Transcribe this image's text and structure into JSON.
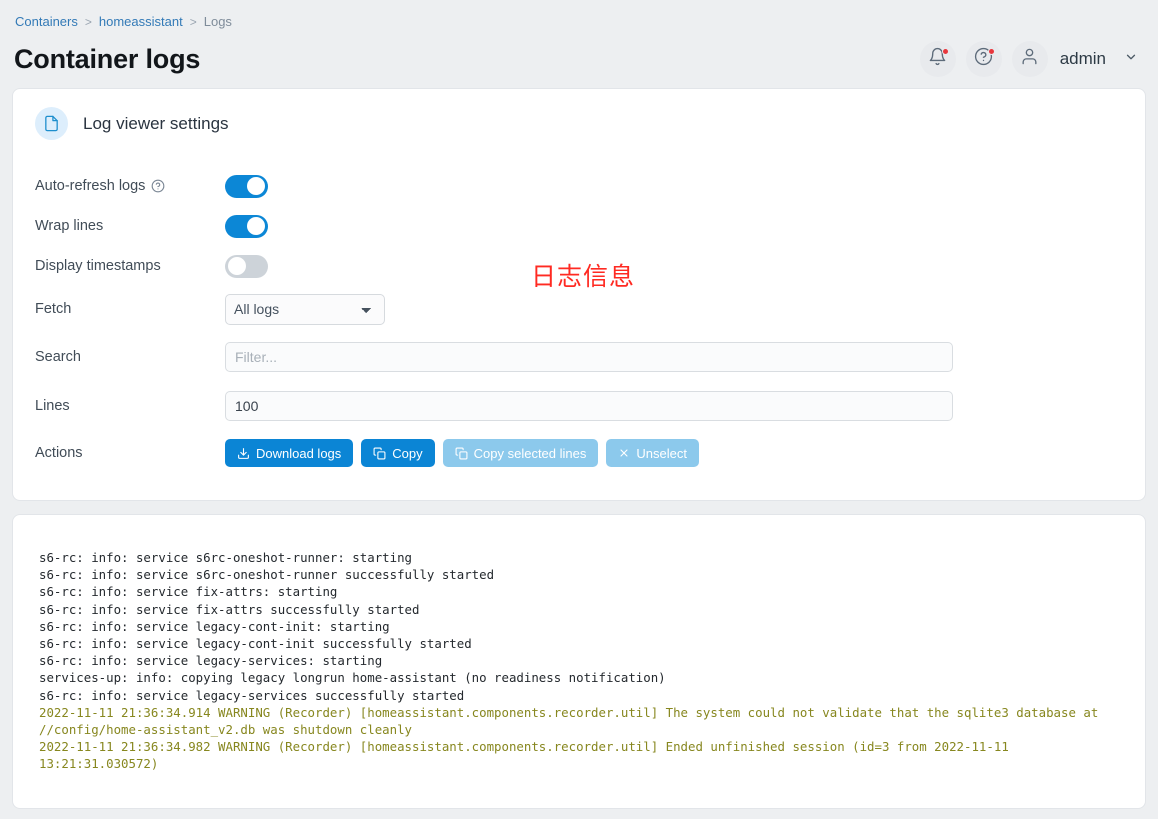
{
  "breadcrumb": {
    "items": [
      {
        "label": "Containers",
        "link": true
      },
      {
        "label": "homeassistant",
        "link": true
      },
      {
        "label": "Logs",
        "link": false
      }
    ],
    "separator": ">"
  },
  "header": {
    "title": "Container logs",
    "user": "admin",
    "notifications_icon": "bell-icon",
    "help_icon": "help-circle-icon",
    "avatar_icon": "user-icon",
    "chevron": "⌄"
  },
  "settings": {
    "card_title": "Log viewer settings",
    "card_icon": "document-icon",
    "annotation": "日志信息",
    "annotation_color": "#ff2a22",
    "rows": {
      "auto_refresh_label": "Auto-refresh logs",
      "auto_refresh_state": "on",
      "wrap_lines_label": "Wrap lines",
      "wrap_lines_state": "on",
      "timestamps_label": "Display timestamps",
      "timestamps_state": "off",
      "fetch_label": "Fetch",
      "fetch_value": "All logs",
      "fetch_options": [
        "All logs"
      ],
      "search_label": "Search",
      "search_value": "",
      "search_placeholder": "Filter...",
      "lines_label": "Lines",
      "lines_value": "100",
      "actions_label": "Actions"
    },
    "buttons": [
      {
        "label": "Download logs",
        "icon": "download-icon",
        "enabled": true
      },
      {
        "label": "Copy",
        "icon": "copy-icon",
        "enabled": true
      },
      {
        "label": "Copy selected lines",
        "icon": "copy-icon",
        "enabled": false
      },
      {
        "label": "Unselect",
        "icon": "close-icon",
        "enabled": false
      }
    ],
    "accent_color": "#0b85d5",
    "disabled_color": "#8cc9ec"
  },
  "log": {
    "lines": [
      {
        "text": "s6-rc: info: service s6rc-oneshot-runner: starting",
        "level": "info"
      },
      {
        "text": "s6-rc: info: service s6rc-oneshot-runner successfully started",
        "level": "info"
      },
      {
        "text": "s6-rc: info: service fix-attrs: starting",
        "level": "info"
      },
      {
        "text": "s6-rc: info: service fix-attrs successfully started",
        "level": "info"
      },
      {
        "text": "s6-rc: info: service legacy-cont-init: starting",
        "level": "info"
      },
      {
        "text": "s6-rc: info: service legacy-cont-init successfully started",
        "level": "info"
      },
      {
        "text": "s6-rc: info: service legacy-services: starting",
        "level": "info"
      },
      {
        "text": "services-up: info: copying legacy longrun home-assistant (no readiness notification)",
        "level": "info"
      },
      {
        "text": "s6-rc: info: service legacy-services successfully started",
        "level": "info"
      },
      {
        "text": "2022-11-11 21:36:34.914 WARNING (Recorder) [homeassistant.components.recorder.util] The system could not validate that the sqlite3 database at //config/home-assistant_v2.db was shutdown cleanly",
        "level": "warning"
      },
      {
        "text": "2022-11-11 21:36:34.982 WARNING (Recorder) [homeassistant.components.recorder.util] Ended unfinished session (id=3 from 2022-11-11 13:21:31.030572)",
        "level": "warning"
      }
    ],
    "warning_color": "#87871f"
  }
}
